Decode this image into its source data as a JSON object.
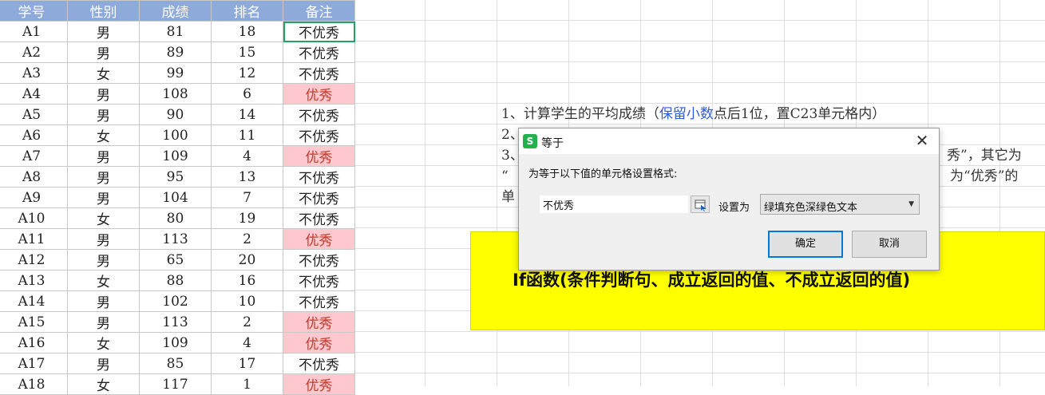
{
  "sheet": {
    "headers": [
      "学号",
      "性别",
      "成绩",
      "排名",
      "备注"
    ],
    "rows": [
      {
        "id": "A1",
        "gender": "男",
        "score": "81",
        "rank": "18",
        "remark": "不优秀"
      },
      {
        "id": "A2",
        "gender": "男",
        "score": "89",
        "rank": "15",
        "remark": "不优秀"
      },
      {
        "id": "A3",
        "gender": "女",
        "score": "99",
        "rank": "12",
        "remark": "不优秀"
      },
      {
        "id": "A4",
        "gender": "男",
        "score": "108",
        "rank": "6",
        "remark": "优秀"
      },
      {
        "id": "A5",
        "gender": "男",
        "score": "90",
        "rank": "14",
        "remark": "不优秀"
      },
      {
        "id": "A6",
        "gender": "女",
        "score": "100",
        "rank": "11",
        "remark": "不优秀"
      },
      {
        "id": "A7",
        "gender": "男",
        "score": "109",
        "rank": "4",
        "remark": "优秀"
      },
      {
        "id": "A8",
        "gender": "男",
        "score": "95",
        "rank": "13",
        "remark": "不优秀"
      },
      {
        "id": "A9",
        "gender": "男",
        "score": "104",
        "rank": "7",
        "remark": "不优秀"
      },
      {
        "id": "A10",
        "gender": "女",
        "score": "80",
        "rank": "19",
        "remark": "不优秀"
      },
      {
        "id": "A11",
        "gender": "男",
        "score": "113",
        "rank": "2",
        "remark": "优秀"
      },
      {
        "id": "A12",
        "gender": "男",
        "score": "65",
        "rank": "20",
        "remark": "不优秀"
      },
      {
        "id": "A13",
        "gender": "女",
        "score": "88",
        "rank": "16",
        "remark": "不优秀"
      },
      {
        "id": "A14",
        "gender": "男",
        "score": "102",
        "rank": "10",
        "remark": "不优秀"
      },
      {
        "id": "A15",
        "gender": "男",
        "score": "113",
        "rank": "2",
        "remark": "优秀"
      },
      {
        "id": "A16",
        "gender": "女",
        "score": "109",
        "rank": "4",
        "remark": "优秀"
      },
      {
        "id": "A17",
        "gender": "男",
        "score": "85",
        "rank": "17",
        "remark": "不优秀"
      },
      {
        "id": "A18",
        "gender": "女",
        "score": "117",
        "rank": "1",
        "remark": "优秀"
      }
    ]
  },
  "instructions": {
    "line1_a": "1、计算学生的平均成绩（",
    "line1_blue": "保留小数",
    "line1_b": "点后1位，置C23单元格内）",
    "line2": "2、",
    "line3_a": "3、",
    "line3_b": "秀”，其它为",
    "line4_a": "“",
    "line4_b": "为“优秀”的",
    "line5": "单"
  },
  "yellow_box": {
    "text": "If函数(条件判断句、成立返回的值、不成立返回的值)"
  },
  "dialog": {
    "app_icon": "S",
    "title": "等于",
    "close_glyph": "✕",
    "prompt": "为等于以下值的单元格设置格式:",
    "value": "不优秀",
    "set_as_label": "设置为",
    "format_option": "绿填充色深绿色文本",
    "ok_label": "确定",
    "cancel_label": "取消"
  },
  "colors": {
    "header_bg": "#8eaadb",
    "highlight_bg": "#ffc7ce",
    "highlight_text": "#c0392b",
    "yellow": "#ffff00",
    "selection": "#21a366",
    "link_blue": "#2e5bd9"
  }
}
